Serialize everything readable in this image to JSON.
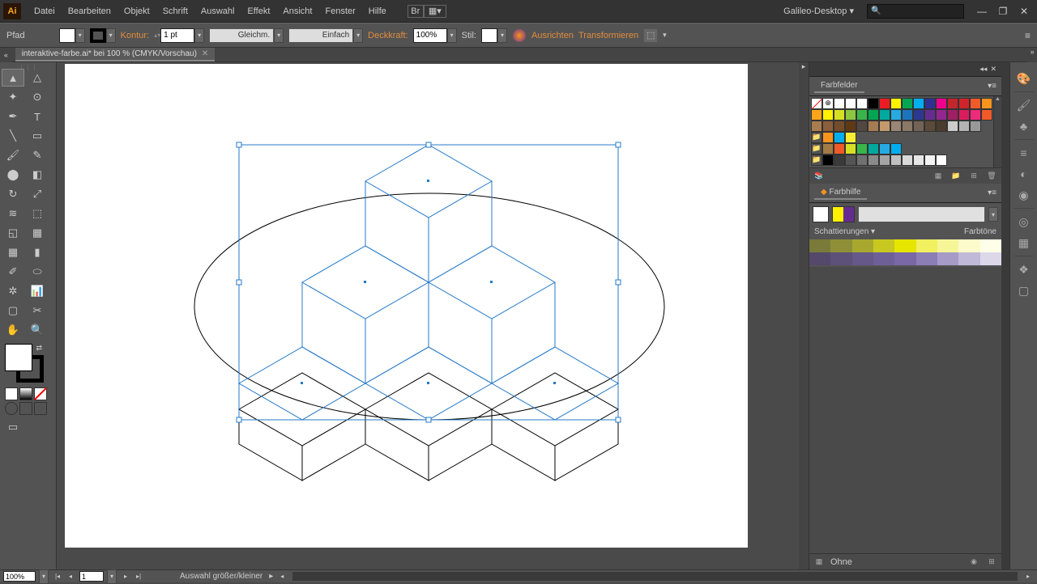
{
  "menu": {
    "logo": "Ai",
    "items": [
      "Datei",
      "Bearbeiten",
      "Objekt",
      "Schrift",
      "Auswahl",
      "Effekt",
      "Ansicht",
      "Fenster",
      "Hilfe"
    ],
    "workspace": "Galileo-Desktop"
  },
  "control": {
    "object_type": "Pfad",
    "kontur_label": "Kontur:",
    "stroke_value": "1 pt",
    "stroke_type": "Gleichm.",
    "brush": "Einfach",
    "opacity_label": "Deckkraft:",
    "opacity_value": "100%",
    "style_label": "Stil:",
    "align_label": "Ausrichten",
    "transform_label": "Transformieren"
  },
  "document": {
    "tab_title": "interaktive-farbe.ai* bei 100 % (CMYK/Vorschau)"
  },
  "panels": {
    "swatches_title": "Farbfelder",
    "guide_title": "Farbhilfe",
    "guide_shade_label": "Schattierungen",
    "guide_tint_label": "Farbtöne",
    "guide_footer": "Ohne"
  },
  "swatch_colors": {
    "row1": [
      "#ffffff",
      "#ffffff",
      "#ffffff",
      "#000000",
      "#ed1c24",
      "#fff200",
      "#00a651",
      "#00aeef",
      "#2e3192",
      "#ec008c",
      "#c0272d",
      "#d2232a",
      "#f15a29",
      "#f7941e",
      "#f9a61a"
    ],
    "row2": [
      "#fff200",
      "#d7df23",
      "#8dc63f",
      "#39b54a",
      "#00a651",
      "#00a99d",
      "#27aae1",
      "#1c75bc",
      "#2b3990",
      "#662d91",
      "#92278f",
      "#9e1f63",
      "#da1c5c",
      "#ee2a7b",
      "#f05a28"
    ],
    "row3": [
      "#a97c50",
      "#8b5e3c",
      "#754c29",
      "#603913",
      "#534741",
      "#a67c52",
      "#c49a6c",
      "#998675",
      "#8a7967",
      "#736357",
      "#5b4a3a",
      "#4a3c2e",
      "#cccccc",
      "#b3b3b3",
      "#999999"
    ],
    "row4": [
      "#f7941e",
      "#00aeef",
      "#f9ed32"
    ],
    "row5": [
      "#a37b45",
      "#f05a28",
      "#d7df23",
      "#39b54a",
      "#00a99d",
      "#27aae1",
      "#00aeef"
    ],
    "row6": [
      "#000000",
      "#3a3a3a",
      "#555555",
      "#707070",
      "#8a8a8a",
      "#a4a4a4",
      "#bfbfbf",
      "#d9d9d9",
      "#e6e6e6",
      "#f2f2f2",
      "#ffffff"
    ]
  },
  "guide_strip1": [
    "#7a7a3a",
    "#8f8f38",
    "#a8a82f",
    "#c8c820",
    "#e5e500",
    "#f0f060",
    "#f6f699",
    "#fbfbcc",
    "#ffffe8"
  ],
  "guide_strip2": [
    "#54496b",
    "#5d5079",
    "#665888",
    "#6f5f97",
    "#7967a6",
    "#8b7db5",
    "#a59bc6",
    "#c0b9d8",
    "#dcd8ea"
  ],
  "guide_base_colors": [
    "#fff200",
    "#662d91"
  ],
  "status": {
    "zoom": "100%",
    "page": "1",
    "tool": "Auswahl größer/kleiner"
  }
}
